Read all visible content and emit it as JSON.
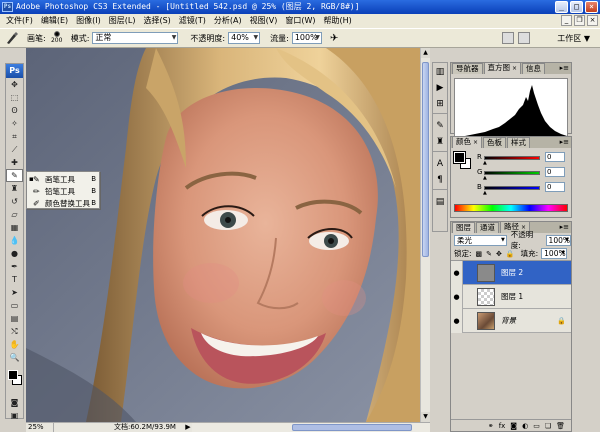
{
  "window": {
    "title": "Adobe Photoshop CS3 Extended - [Untitled 542.psd @ 25% (图层 2, RGB/8#)]",
    "app_icon_label": "Ps",
    "controls": [
      "_",
      "□",
      "×"
    ]
  },
  "menu": {
    "items": [
      "文件(F)",
      "编辑(E)",
      "图像(I)",
      "图层(L)",
      "选择(S)",
      "滤镜(T)",
      "分析(A)",
      "视图(V)",
      "窗口(W)",
      "帮助(H)"
    ]
  },
  "options_bar": {
    "brush_label": "画笔:",
    "brush_size": "200",
    "mode_label": "模式:",
    "mode_value": "正常",
    "opacity_label": "不透明度:",
    "opacity_value": "40%",
    "flow_label": "流量:",
    "flow_value": "100%",
    "workspace_label": "工作区 ▼"
  },
  "toolbox": {
    "logo": "Ps"
  },
  "flyout": {
    "items": [
      {
        "label": "画笔工具",
        "key": "B",
        "selected": true
      },
      {
        "label": "铅笔工具",
        "key": "B",
        "selected": false
      },
      {
        "label": "颜色替换工具",
        "key": "B",
        "selected": false
      }
    ]
  },
  "status": {
    "zoom": "25%",
    "doc": "文档:60.2M/93.9M"
  },
  "panels": {
    "navigator_tabs": [
      "导航器",
      "直方图",
      "信息"
    ],
    "color_tabs": [
      "颜色",
      "色板",
      "样式"
    ],
    "color_rows": [
      {
        "channel": "R",
        "value": "0"
      },
      {
        "channel": "G",
        "value": "0"
      },
      {
        "channel": "B",
        "value": "0"
      }
    ],
    "layers_tabs": [
      "图层",
      "通道",
      "路径"
    ],
    "blend_mode": "柔光",
    "opacity_label": "不透明度:",
    "opacity_value": "100%",
    "lock_label": "锁定:",
    "fill_label": "填充:",
    "fill_value": "100%",
    "layers": [
      {
        "name": "图层 2",
        "selected": true
      },
      {
        "name": "图层 1",
        "selected": false
      },
      {
        "name": "背景",
        "selected": false
      }
    ]
  },
  "colors": {
    "title_bar": "#0a3fb8",
    "selection": "#3163c5"
  }
}
